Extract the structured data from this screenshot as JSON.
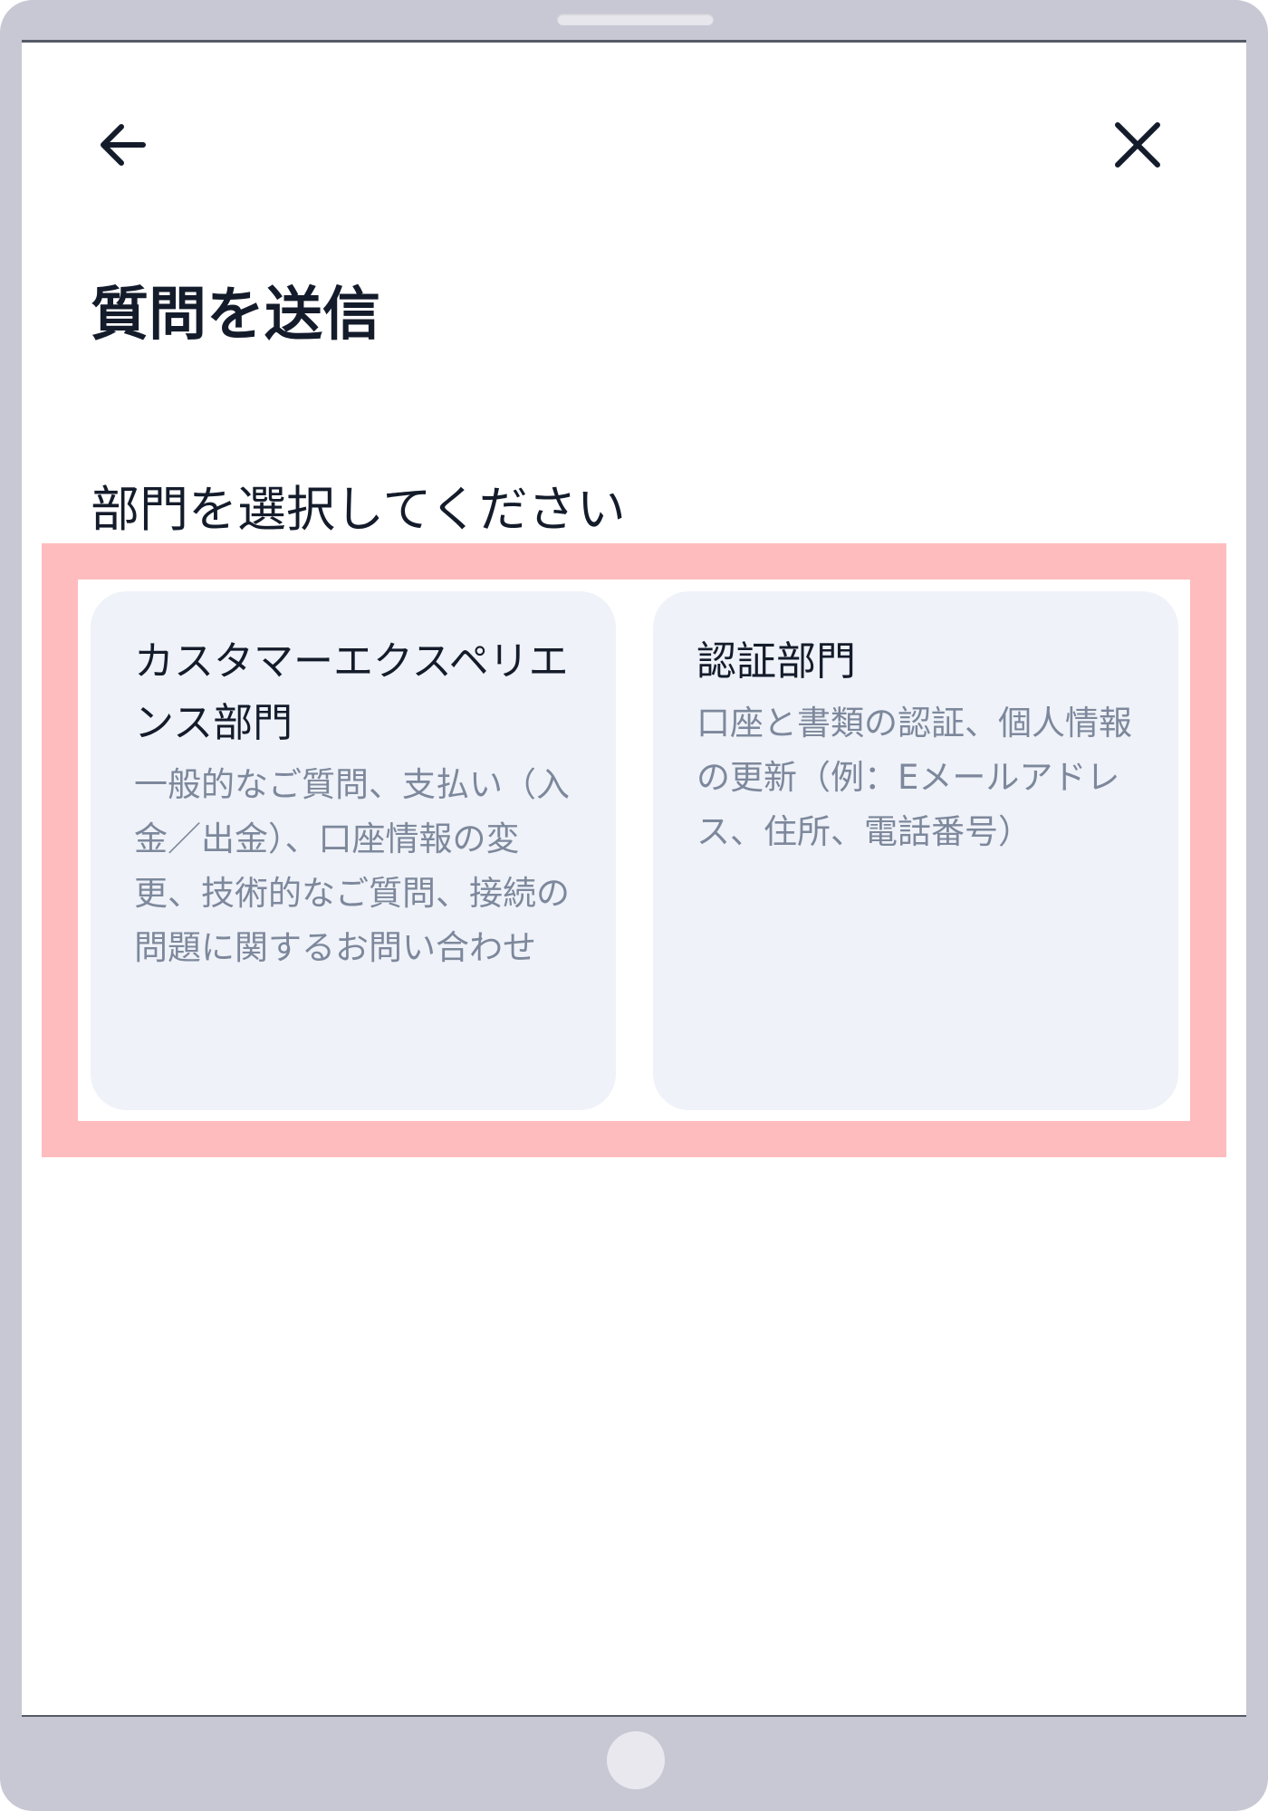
{
  "header": {
    "back_icon": "arrow-left-icon",
    "close_icon": "close-icon",
    "title": "質問を送信"
  },
  "section": {
    "label": "部門を選択してください"
  },
  "departments": [
    {
      "title": "カスタマーエクスペリエンス部門",
      "description": "一般的なご質問、支払い（入金／出金）、口座情報の変更、技術的なご質問、接続の問題に関するお問い合わせ"
    },
    {
      "title": "認証部門",
      "description": "口座と書類の認証、個人情報の更新（例：Eメールアドレス、住所、電話番号）"
    }
  ],
  "colors": {
    "highlight": "#ffbcbe",
    "card_background": "#eff2f8",
    "title_text": "#141c2b",
    "description_text": "#7d889c"
  }
}
